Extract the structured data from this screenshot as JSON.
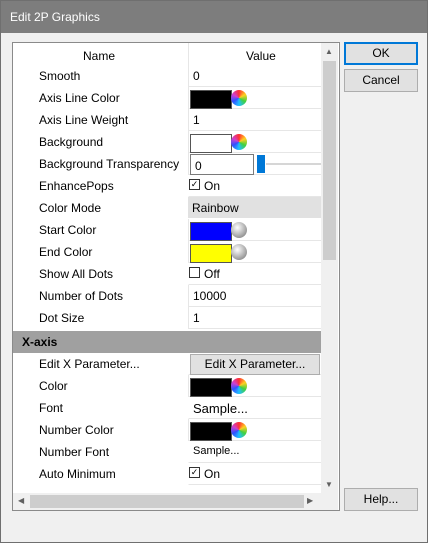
{
  "window": {
    "title": "Edit 2P Graphics"
  },
  "grid": {
    "header": {
      "name": "Name",
      "value": "Value"
    },
    "rows": [
      {
        "name": "Smooth",
        "value": "0"
      },
      {
        "name": "Axis Line Color",
        "color": "#000000"
      },
      {
        "name": "Axis Line Weight",
        "value": "1"
      },
      {
        "name": "Background",
        "color": "#ffffff"
      },
      {
        "name": "Background Transparency",
        "value": "0"
      },
      {
        "name": "EnhancePops",
        "value": "On",
        "checked": true
      },
      {
        "name": "Color Mode",
        "value": "Rainbow"
      },
      {
        "name": "Start Color",
        "color": "#0000ff"
      },
      {
        "name": "End Color",
        "color": "#ffff00"
      },
      {
        "name": "Show All Dots",
        "value": "Off",
        "checked": false
      },
      {
        "name": "Number of Dots",
        "value": "10000"
      },
      {
        "name": "Dot Size",
        "value": "1"
      }
    ],
    "section_xaxis": "X-axis",
    "xrows": [
      {
        "name": "Edit X Parameter...",
        "button": "Edit X Parameter..."
      },
      {
        "name": "Color",
        "color": "#000000"
      },
      {
        "name": "Font",
        "value": "Sample..."
      },
      {
        "name": "Number Color",
        "color": "#000000"
      },
      {
        "name": "Number Font",
        "value": "Sample..."
      },
      {
        "name": "Auto Minimum",
        "value": "On",
        "checked": true
      }
    ]
  },
  "buttons": {
    "ok": "OK",
    "cancel": "Cancel",
    "help": "Help..."
  }
}
